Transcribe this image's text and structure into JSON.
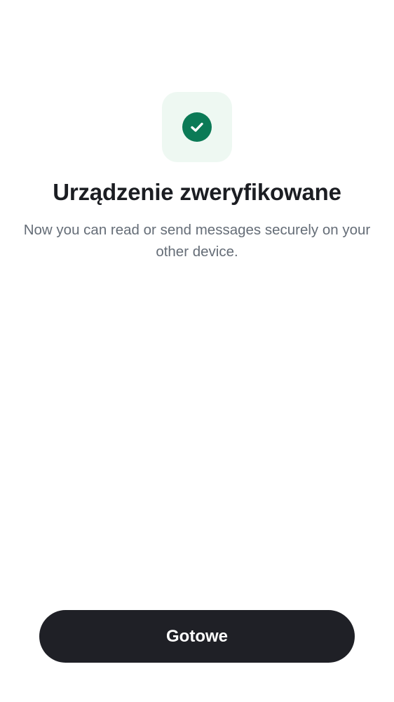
{
  "verification": {
    "icon": "check-circle-icon",
    "title": "Urządzenie zweryfikowane",
    "subtitle": "Now you can read or send messages securely on your other device."
  },
  "actions": {
    "done_label": "Gotowe"
  },
  "colors": {
    "accent_green": "#0b7a56",
    "icon_tile_bg": "#eef8f2",
    "title_text": "#1b1d22",
    "subtitle_text": "#656d77",
    "button_bg": "#1f2026",
    "button_text": "#ffffff"
  }
}
